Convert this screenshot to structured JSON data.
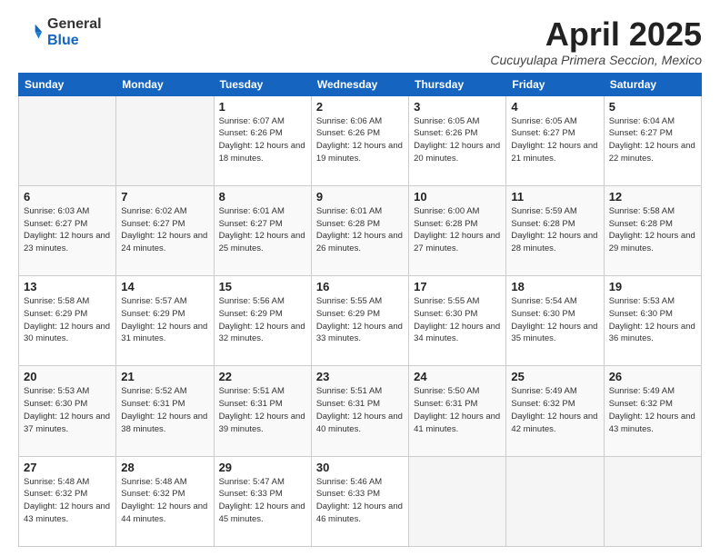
{
  "logo": {
    "general": "General",
    "blue": "Blue"
  },
  "title": "April 2025",
  "location": "Cucuyulapa Primera Seccion, Mexico",
  "days_of_week": [
    "Sunday",
    "Monday",
    "Tuesday",
    "Wednesday",
    "Thursday",
    "Friday",
    "Saturday"
  ],
  "weeks": [
    [
      {
        "day": "",
        "empty": true
      },
      {
        "day": "",
        "empty": true
      },
      {
        "day": "1",
        "sunrise": "6:07 AM",
        "sunset": "6:26 PM",
        "daylight": "12 hours and 18 minutes."
      },
      {
        "day": "2",
        "sunrise": "6:06 AM",
        "sunset": "6:26 PM",
        "daylight": "12 hours and 19 minutes."
      },
      {
        "day": "3",
        "sunrise": "6:05 AM",
        "sunset": "6:26 PM",
        "daylight": "12 hours and 20 minutes."
      },
      {
        "day": "4",
        "sunrise": "6:05 AM",
        "sunset": "6:27 PM",
        "daylight": "12 hours and 21 minutes."
      },
      {
        "day": "5",
        "sunrise": "6:04 AM",
        "sunset": "6:27 PM",
        "daylight": "12 hours and 22 minutes."
      }
    ],
    [
      {
        "day": "6",
        "sunrise": "6:03 AM",
        "sunset": "6:27 PM",
        "daylight": "12 hours and 23 minutes."
      },
      {
        "day": "7",
        "sunrise": "6:02 AM",
        "sunset": "6:27 PM",
        "daylight": "12 hours and 24 minutes."
      },
      {
        "day": "8",
        "sunrise": "6:01 AM",
        "sunset": "6:27 PM",
        "daylight": "12 hours and 25 minutes."
      },
      {
        "day": "9",
        "sunrise": "6:01 AM",
        "sunset": "6:28 PM",
        "daylight": "12 hours and 26 minutes."
      },
      {
        "day": "10",
        "sunrise": "6:00 AM",
        "sunset": "6:28 PM",
        "daylight": "12 hours and 27 minutes."
      },
      {
        "day": "11",
        "sunrise": "5:59 AM",
        "sunset": "6:28 PM",
        "daylight": "12 hours and 28 minutes."
      },
      {
        "day": "12",
        "sunrise": "5:58 AM",
        "sunset": "6:28 PM",
        "daylight": "12 hours and 29 minutes."
      }
    ],
    [
      {
        "day": "13",
        "sunrise": "5:58 AM",
        "sunset": "6:29 PM",
        "daylight": "12 hours and 30 minutes."
      },
      {
        "day": "14",
        "sunrise": "5:57 AM",
        "sunset": "6:29 PM",
        "daylight": "12 hours and 31 minutes."
      },
      {
        "day": "15",
        "sunrise": "5:56 AM",
        "sunset": "6:29 PM",
        "daylight": "12 hours and 32 minutes."
      },
      {
        "day": "16",
        "sunrise": "5:55 AM",
        "sunset": "6:29 PM",
        "daylight": "12 hours and 33 minutes."
      },
      {
        "day": "17",
        "sunrise": "5:55 AM",
        "sunset": "6:30 PM",
        "daylight": "12 hours and 34 minutes."
      },
      {
        "day": "18",
        "sunrise": "5:54 AM",
        "sunset": "6:30 PM",
        "daylight": "12 hours and 35 minutes."
      },
      {
        "day": "19",
        "sunrise": "5:53 AM",
        "sunset": "6:30 PM",
        "daylight": "12 hours and 36 minutes."
      }
    ],
    [
      {
        "day": "20",
        "sunrise": "5:53 AM",
        "sunset": "6:30 PM",
        "daylight": "12 hours and 37 minutes."
      },
      {
        "day": "21",
        "sunrise": "5:52 AM",
        "sunset": "6:31 PM",
        "daylight": "12 hours and 38 minutes."
      },
      {
        "day": "22",
        "sunrise": "5:51 AM",
        "sunset": "6:31 PM",
        "daylight": "12 hours and 39 minutes."
      },
      {
        "day": "23",
        "sunrise": "5:51 AM",
        "sunset": "6:31 PM",
        "daylight": "12 hours and 40 minutes."
      },
      {
        "day": "24",
        "sunrise": "5:50 AM",
        "sunset": "6:31 PM",
        "daylight": "12 hours and 41 minutes."
      },
      {
        "day": "25",
        "sunrise": "5:49 AM",
        "sunset": "6:32 PM",
        "daylight": "12 hours and 42 minutes."
      },
      {
        "day": "26",
        "sunrise": "5:49 AM",
        "sunset": "6:32 PM",
        "daylight": "12 hours and 43 minutes."
      }
    ],
    [
      {
        "day": "27",
        "sunrise": "5:48 AM",
        "sunset": "6:32 PM",
        "daylight": "12 hours and 43 minutes."
      },
      {
        "day": "28",
        "sunrise": "5:48 AM",
        "sunset": "6:32 PM",
        "daylight": "12 hours and 44 minutes."
      },
      {
        "day": "29",
        "sunrise": "5:47 AM",
        "sunset": "6:33 PM",
        "daylight": "12 hours and 45 minutes."
      },
      {
        "day": "30",
        "sunrise": "5:46 AM",
        "sunset": "6:33 PM",
        "daylight": "12 hours and 46 minutes."
      },
      {
        "day": "",
        "empty": true
      },
      {
        "day": "",
        "empty": true
      },
      {
        "day": "",
        "empty": true
      }
    ]
  ]
}
